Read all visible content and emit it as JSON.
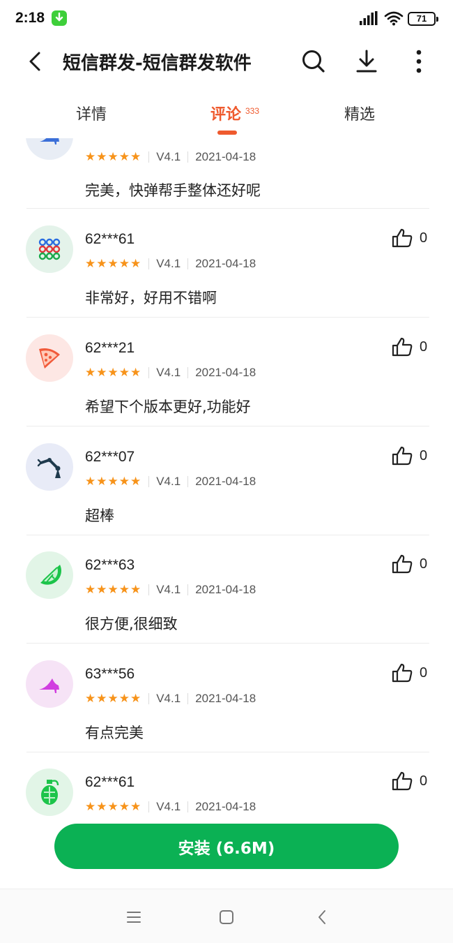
{
  "status_bar": {
    "time": "2:18",
    "battery": "71"
  },
  "app_bar": {
    "title": "短信群发-短信群发软件"
  },
  "tabs": [
    {
      "label": "详情",
      "active": false
    },
    {
      "label": "评论",
      "count": "333",
      "active": true
    },
    {
      "label": "精选",
      "active": false
    }
  ],
  "colors": {
    "accent": "#ef5a2e",
    "install": "#0bb154",
    "star": "#f7931a"
  },
  "reviews": [
    {
      "user": "",
      "icon": "high-heel-icon",
      "stars": "★★★★★",
      "version": "V4.1",
      "date": "2021-04-18",
      "comment": "完美，快弹帮手整体还好呢",
      "likes": ""
    },
    {
      "user": "62***61",
      "icon": "beads-grid-icon",
      "stars": "★★★★★",
      "version": "V4.1",
      "date": "2021-04-18",
      "comment": "非常好，好用不错啊",
      "likes": "0"
    },
    {
      "user": "62***21",
      "icon": "pizza-slice-icon",
      "stars": "★★★★★",
      "version": "V4.1",
      "date": "2021-04-18",
      "comment": "希望下个版本更好,功能好",
      "likes": "0"
    },
    {
      "user": "62***07",
      "icon": "robot-arm-icon",
      "stars": "★★★★★",
      "version": "V4.1",
      "date": "2021-04-18",
      "comment": "超棒",
      "likes": "0"
    },
    {
      "user": "62***63",
      "icon": "lime-slice-icon",
      "stars": "★★★★★",
      "version": "V4.1",
      "date": "2021-04-18",
      "comment": "很方便,很细致",
      "likes": "0"
    },
    {
      "user": "63***56",
      "icon": "high-heel-icon",
      "stars": "★★★★★",
      "version": "V4.1",
      "date": "2021-04-18",
      "comment": "有点完美",
      "likes": "0"
    },
    {
      "user": "62***61",
      "icon": "grenade-icon",
      "stars": "★★★★★",
      "version": "V4.1",
      "date": "2021-04-18",
      "comment": "",
      "likes": "0"
    }
  ],
  "install_button": {
    "label": "安装 (6.6M)"
  }
}
